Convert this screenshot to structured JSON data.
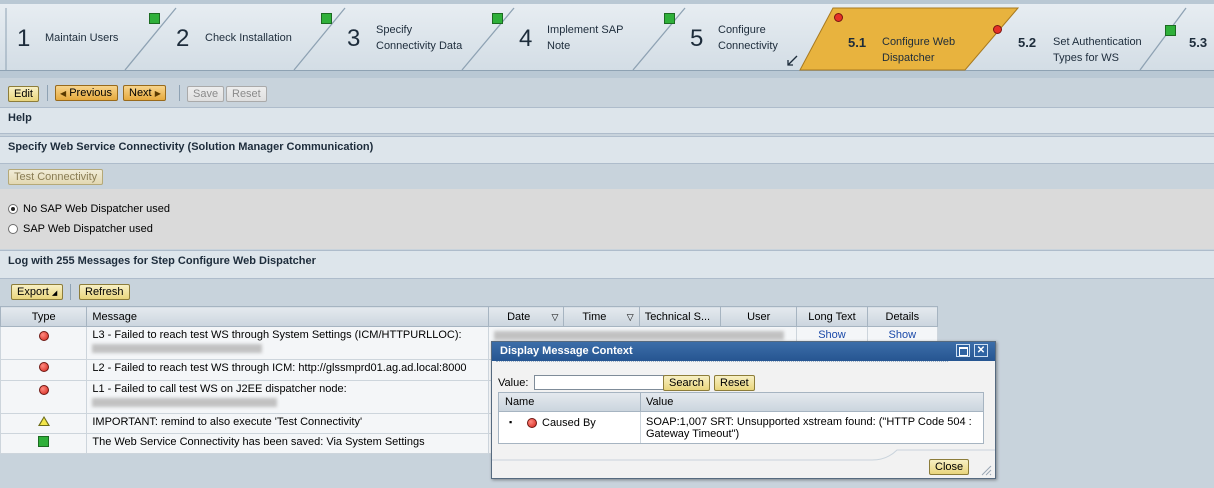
{
  "roadmap": {
    "steps": [
      {
        "num": "1",
        "label": "Maintain Users",
        "status": "green"
      },
      {
        "num": "2",
        "label": "Check Installation",
        "status": "green"
      },
      {
        "num": "3",
        "label_line1": "Specify",
        "label_line2": "Connectivity Data",
        "status": "green"
      },
      {
        "num": "4",
        "label_line1": "Implement SAP",
        "label_line2": "Note",
        "status": "green"
      },
      {
        "num": "5",
        "label_line1": "Configure",
        "label_line2": "Connectivity",
        "status": "red"
      },
      {
        "num": "5.1",
        "label_line1": "Configure Web",
        "label_line2": "Dispatcher",
        "status": "red",
        "active": true
      },
      {
        "num": "5.2",
        "label_line1": "Set Authentication",
        "label_line2": "Types for WS",
        "status": "green"
      },
      {
        "num": "5.3",
        "label": "",
        "status": "none"
      }
    ],
    "active_color": "#e8b33e"
  },
  "toolbar": {
    "edit": "Edit",
    "previous": "Previous",
    "next": "Next",
    "save": "Save",
    "reset": "Reset"
  },
  "help": {
    "title": "Help"
  },
  "section": {
    "title": "Specify Web Service Connectivity (Solution Manager Communication)",
    "test_button": "Test Connectivity",
    "radio_no": "No SAP Web Dispatcher used",
    "radio_yes": "SAP Web Dispatcher used"
  },
  "log": {
    "title": "Log with 255 Messages for Step Configure Web Dispatcher",
    "export": "Export",
    "refresh": "Refresh",
    "columns": [
      "Type",
      "Message",
      "Date",
      "Time",
      "Technical S...",
      "User",
      "Long Text",
      "Details"
    ],
    "show": "Show",
    "rows": [
      {
        "type": "error",
        "message": "L3 - Failed to reach test WS through System Settings (ICM/HTTPURLLOC):"
      },
      {
        "type": "error",
        "message": "L2 - Failed to reach test WS through ICM: http://glssmprd01.ag.ad.local:8000"
      },
      {
        "type": "error",
        "message": "L1 - Failed to call test WS on J2EE dispatcher node:"
      },
      {
        "type": "warning",
        "message": "IMPORTANT: remind to also execute 'Test Connectivity'"
      },
      {
        "type": "success",
        "message": "The Web Service Connectivity has been saved: Via System Settings"
      }
    ]
  },
  "dialog": {
    "title": "Display Message Context",
    "value_label": "Value:",
    "value_input": "",
    "search": "Search",
    "reset": "Reset",
    "col_name": "Name",
    "col_value": "Value",
    "row_name": "Caused By",
    "row_value_line1": "SOAP:1,007 SRT: Unsupported xstream found: (\"HTTP Code 504 :",
    "row_value_line2": "Gateway Timeout\")",
    "close": "Close"
  }
}
